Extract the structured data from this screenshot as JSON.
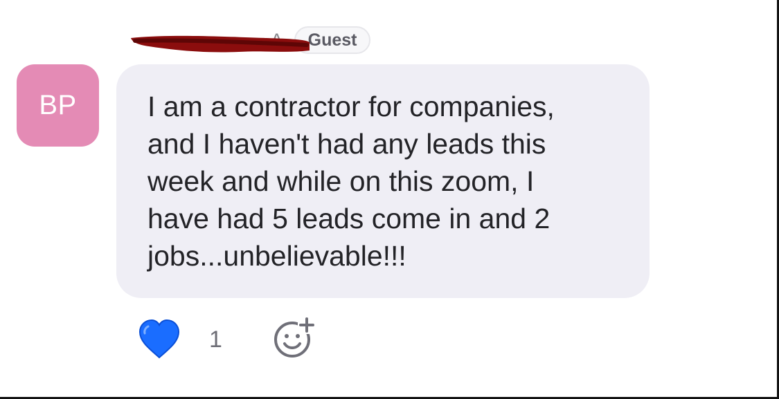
{
  "message": {
    "avatar_initials": "BP",
    "sender_name_suffix": "A",
    "sender_badge": "Guest",
    "text": "I am a contractor for companies,\nand I haven't had any leads this\nweek and while on this zoom, I\nhave had 5 leads come in and 2\njobs...unbelievable!!!",
    "avatar_color": "#e48bb5",
    "bubble_color": "#efeef5"
  },
  "reactions": {
    "emoji": "heart-icon",
    "count": "1",
    "heart_color": "#1a6dff"
  }
}
